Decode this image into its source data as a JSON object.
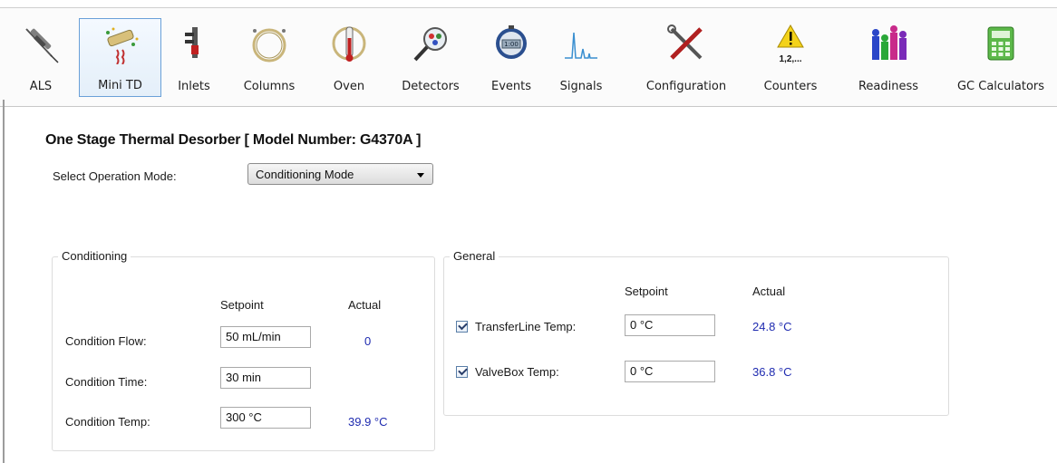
{
  "toolbar": {
    "items": [
      {
        "label": "ALS",
        "icon": "syringe-icon"
      },
      {
        "label": "Mini TD",
        "icon": "thermal-desorber-icon",
        "selected": true
      },
      {
        "label": "Inlets",
        "icon": "inlet-icon"
      },
      {
        "label": "Columns",
        "icon": "column-coil-icon"
      },
      {
        "label": "Oven",
        "icon": "oven-icon"
      },
      {
        "label": "Detectors",
        "icon": "magnifier-icon"
      },
      {
        "label": "Events",
        "icon": "stopwatch-icon"
      },
      {
        "label": "Signals",
        "icon": "chromatogram-icon"
      },
      {
        "label": "Configuration",
        "icon": "tools-icon"
      },
      {
        "label": "Counters",
        "icon": "warning-counter-icon",
        "counter_text": "1,2,..."
      },
      {
        "label": "Readiness",
        "icon": "bar-people-icon"
      },
      {
        "label": "GC Calculators",
        "icon": "calculator-icon"
      }
    ]
  },
  "page": {
    "title": "One Stage Thermal Desorber [ Model Number: G4370A ]",
    "mode_label": "Select Operation Mode:",
    "mode_value": "Conditioning Mode"
  },
  "conditioning": {
    "title": "Conditioning",
    "setpoint_header": "Setpoint",
    "actual_header": "Actual",
    "rows": [
      {
        "label": "Condition Flow:",
        "setpoint": "50 mL/min",
        "actual": "0"
      },
      {
        "label": "Condition Time:",
        "setpoint": "30 min",
        "actual": ""
      },
      {
        "label": "Condition Temp:",
        "setpoint": "300 °C",
        "actual": "39.9 °C"
      }
    ]
  },
  "general": {
    "title": "General",
    "setpoint_header": "Setpoint",
    "actual_header": "Actual",
    "rows": [
      {
        "label": "TransferLine Temp:",
        "checked": true,
        "setpoint": "0 °C",
        "actual": "24.8 °C"
      },
      {
        "label": "ValveBox Temp:",
        "checked": true,
        "setpoint": "0 °C",
        "actual": "36.8 °C"
      }
    ]
  },
  "colors": {
    "actual_text": "#1f2bb0",
    "selected_border": "#6aa0d8"
  }
}
